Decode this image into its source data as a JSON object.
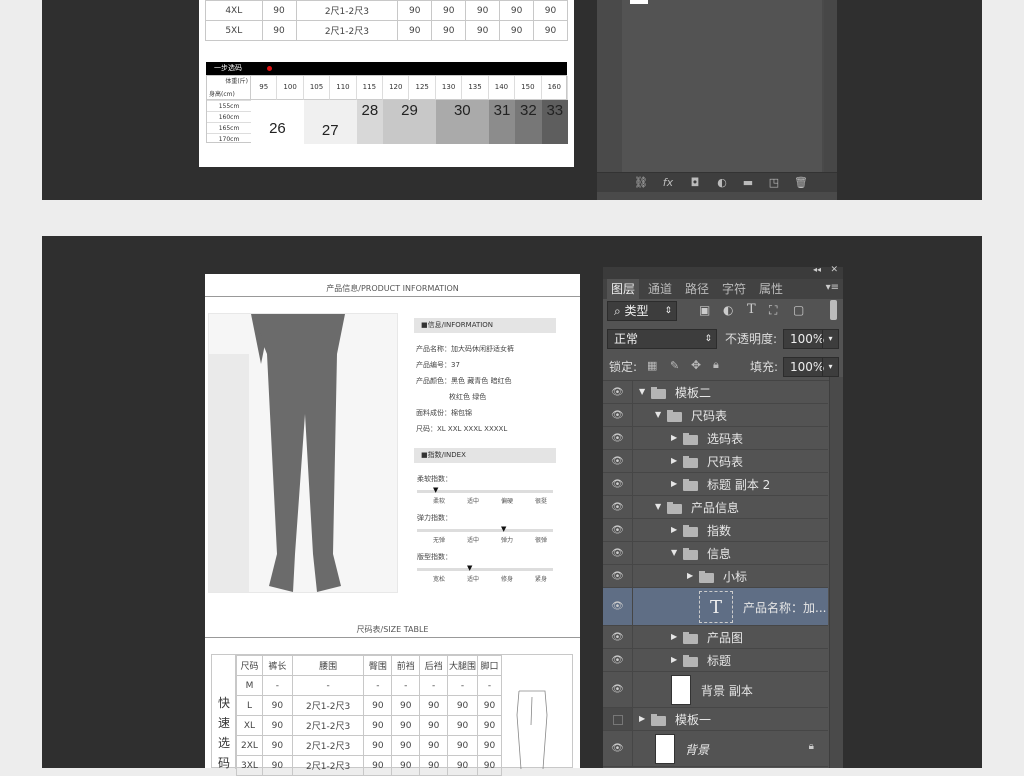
{
  "top_size_table": {
    "rows": [
      [
        "4XL",
        "90",
        "2尺1-2尺3",
        "90",
        "90",
        "90",
        "90",
        "90"
      ],
      [
        "5XL",
        "90",
        "2尺1-2尺3",
        "90",
        "90",
        "90",
        "90",
        "90"
      ]
    ]
  },
  "body_table": {
    "header_label": "一步选码",
    "weight_label": "体重(斤)",
    "height_label": "身高(cm)",
    "weights": [
      "95",
      "100",
      "105",
      "110",
      "115",
      "120",
      "125",
      "130",
      "135",
      "140",
      "150",
      "160"
    ],
    "heights": [
      "155cm",
      "160cm",
      "165cm",
      "170cm"
    ],
    "sizes": [
      "26",
      "27",
      "28",
      "29",
      "30",
      "31",
      "32",
      "33"
    ]
  },
  "product": {
    "section_title": "产品信息/PRODUCT INFORMATION",
    "info_header": "■信息/INFORMATION",
    "info_lines": [
      "产品名称：加大码休闲舒适女裤",
      "产品编号：37",
      "产品颜色：黑色 藏青色 暗红色",
      "枚红色 绿色",
      "面料成份：棉包锦",
      "尺码：XL XXL XXXL XXXXL"
    ],
    "index_header": "■指数/INDEX",
    "indices": [
      {
        "label": "柔软指数：",
        "marks": [
          "柔软",
          "适中",
          "偏硬",
          "很挺"
        ]
      },
      {
        "label": "弹力指数：",
        "marks": [
          "无弹",
          "适中",
          "弹力",
          "很弹"
        ]
      },
      {
        "label": "版型指数：",
        "marks": [
          "宽松",
          "适中",
          "修身",
          "紧身"
        ]
      }
    ],
    "index_selected": [
      0,
      2,
      1
    ]
  },
  "size_table": {
    "section_title": "尺码表/SIZE TABLE",
    "side_label": [
      "快",
      "速",
      "选",
      "码"
    ],
    "headers": [
      "尺码",
      "裤长",
      "腰围",
      "臀围",
      "前裆",
      "后裆",
      "大腿围",
      "脚口"
    ],
    "rows": [
      [
        "M",
        "-",
        "-",
        "-",
        "-",
        "-",
        "-",
        "-"
      ],
      [
        "L",
        "90",
        "2尺1-2尺3",
        "90",
        "90",
        "90",
        "90",
        "90"
      ],
      [
        "XL",
        "90",
        "2尺1-2尺3",
        "90",
        "90",
        "90",
        "90",
        "90"
      ],
      [
        "2XL",
        "90",
        "2尺1-2尺3",
        "90",
        "90",
        "90",
        "90",
        "90"
      ],
      [
        "3XL",
        "90",
        "2尺1-2尺3",
        "90",
        "90",
        "90",
        "90",
        "90"
      ]
    ]
  },
  "layers_panel": {
    "tabs": [
      "图层",
      "通道",
      "路径",
      "字符",
      "属性"
    ],
    "filter_label": "类型",
    "blend_mode": "正常",
    "opacity_label": "不透明度:",
    "opacity_value": "100%",
    "lock_label": "锁定:",
    "fill_label": "填充:",
    "fill_value": "100%",
    "layers": [
      {
        "name": "模板二",
        "indent": 0,
        "type": "folder",
        "open": true,
        "visible": true
      },
      {
        "name": "尺码表",
        "indent": 1,
        "type": "folder",
        "open": true,
        "visible": true
      },
      {
        "name": "选码表",
        "indent": 2,
        "type": "folder",
        "open": false,
        "visible": true
      },
      {
        "name": "尺码表",
        "indent": 2,
        "type": "folder",
        "open": false,
        "visible": true
      },
      {
        "name": "标题 副本 2",
        "indent": 2,
        "type": "folder",
        "open": false,
        "visible": true
      },
      {
        "name": "产品信息",
        "indent": 1,
        "type": "folder",
        "open": true,
        "visible": true
      },
      {
        "name": "指数",
        "indent": 2,
        "type": "folder",
        "open": false,
        "visible": true
      },
      {
        "name": "信息",
        "indent": 2,
        "type": "folder",
        "open": true,
        "visible": true
      },
      {
        "name": "小标",
        "indent": 3,
        "type": "folder",
        "open": false,
        "visible": true
      },
      {
        "name": "产品名称：加...",
        "indent": 3,
        "type": "text",
        "selected": true,
        "visible": true
      },
      {
        "name": "产品图",
        "indent": 2,
        "type": "folder",
        "open": false,
        "visible": true
      },
      {
        "name": "标题",
        "indent": 2,
        "type": "folder",
        "open": false,
        "visible": true
      },
      {
        "name": "背景 副本",
        "indent": 1,
        "type": "image",
        "visible": true
      },
      {
        "name": "模板一",
        "indent": 0,
        "type": "folder",
        "open": false,
        "visible": false
      },
      {
        "name": "背景",
        "indent": 0,
        "type": "image",
        "locked": true,
        "visible": true
      }
    ]
  },
  "colors": {
    "ps_bg": "#535353",
    "ps_selected": "#5f6e85",
    "dark_bg": "#2f2f2f"
  }
}
